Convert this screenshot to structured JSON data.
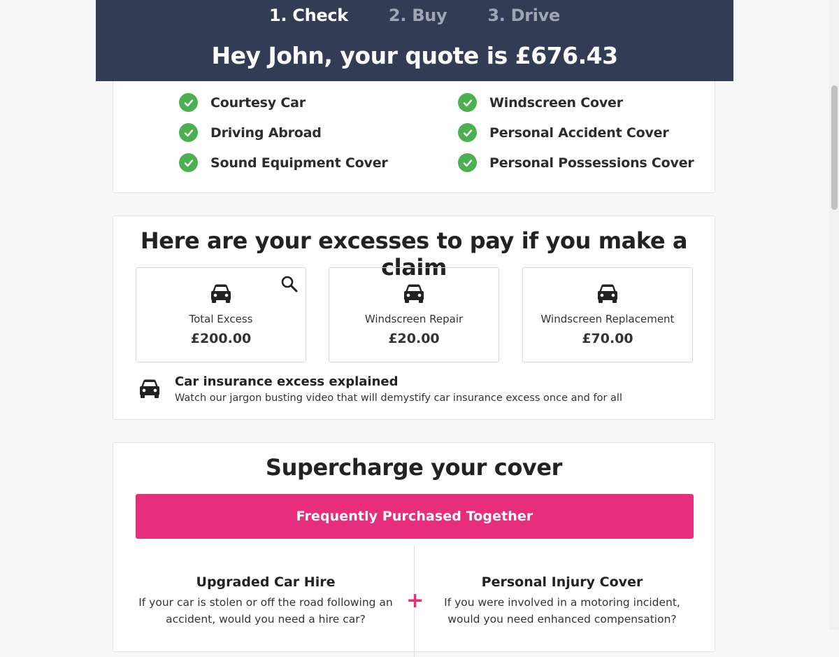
{
  "steps": [
    {
      "label": "1. Check",
      "active": true
    },
    {
      "label": "2. Buy",
      "active": false
    },
    {
      "label": "3. Drive",
      "active": false
    }
  ],
  "quote_title": "Hey John, your quote is £676.43",
  "included_features": {
    "left": [
      "Courtesy Car",
      "Driving Abroad",
      "Sound Equipment Cover"
    ],
    "right": [
      "Windscreen Cover",
      "Personal Accident Cover",
      "Personal Possessions Cover"
    ]
  },
  "excesses": {
    "title": "Here are your excesses to pay if you make a claim",
    "items": [
      {
        "label": "Total Excess",
        "value": "£200.00"
      },
      {
        "label": "Windscreen Repair",
        "value": "£20.00"
      },
      {
        "label": "Windscreen Replacement",
        "value": "£70.00"
      }
    ],
    "explainer": {
      "title": "Car insurance excess explained",
      "description": "Watch our jargon busting video that will demystify car insurance excess once and for all"
    }
  },
  "supercharge": {
    "title": "Supercharge your cover",
    "button_label": "Frequently Purchased Together",
    "plus_symbol": "+",
    "addons": [
      {
        "title": "Upgraded Car Hire",
        "description": "If your car is stolen or off the road following an accident, would you need a hire car?"
      },
      {
        "title": "Personal Injury Cover",
        "description": "If you were involved in a motoring incident, would you need enhanced compensation?"
      }
    ]
  },
  "icons": {
    "check": "check-circle-icon",
    "car": "car-icon",
    "search": "search-icon"
  },
  "colors": {
    "header_bg": "#323c54",
    "accent_pink": "#e72e7d",
    "check_green": "#4caf50"
  }
}
